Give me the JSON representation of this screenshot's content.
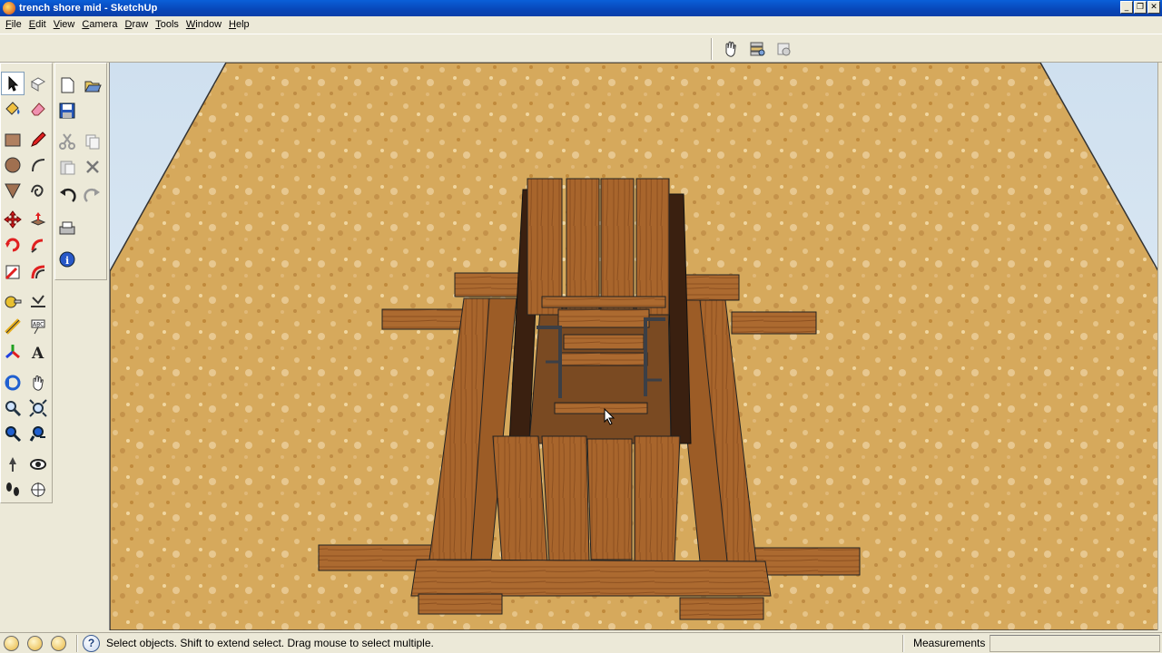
{
  "window": {
    "title": "trench shore mid - SketchUp",
    "buttons": {
      "minimize": "_",
      "restore": "❐",
      "close": "✕"
    }
  },
  "menu": [
    {
      "label": "File",
      "accel": "F",
      "rest": "ile"
    },
    {
      "label": "Edit",
      "accel": "E",
      "rest": "dit"
    },
    {
      "label": "View",
      "accel": "V",
      "rest": "iew"
    },
    {
      "label": "Camera",
      "accel": "C",
      "rest": "amera"
    },
    {
      "label": "Draw",
      "accel": "D",
      "rest": "raw"
    },
    {
      "label": "Tools",
      "accel": "T",
      "rest": "ools"
    },
    {
      "label": "Window",
      "accel": "W",
      "rest": "indow"
    },
    {
      "label": "Help",
      "accel": "H",
      "rest": "elp"
    }
  ],
  "top_toolbar": [
    "pan-hand-icon",
    "layer-manager-icon",
    "layers-icon"
  ],
  "left_toolbar": {
    "column1": [
      "select-icon",
      "paint-bucket-icon",
      "rectangle-icon",
      "circle-icon",
      "polygon-icon",
      "move-icon",
      "rotate-icon",
      "scale-icon",
      "tape-measure-icon",
      "dimension-icon",
      "axes-icon",
      "orbit-icon",
      "zoom-icon",
      "zoom-window-icon",
      "position-camera-icon",
      "walk-icon"
    ],
    "column1b": [
      "component-icon",
      "eraser-icon",
      "pencil-icon",
      "arc-icon",
      "freehand-icon",
      "push-pull-icon",
      "follow-me-icon",
      "offset-icon",
      "protractor-icon",
      "text-icon",
      "3d-text-icon",
      "pan-icon",
      "zoom-extents-icon",
      "previous-view-icon",
      "look-around-icon",
      "section-plane-icon"
    ],
    "column2": [
      "new-icon",
      "save-icon",
      "cut-icon",
      "paste-icon",
      "undo-icon",
      "print-icon",
      "model-info-icon"
    ],
    "column2b": [
      "open-icon",
      "copy-icon",
      "delete-icon",
      "redo-icon"
    ]
  },
  "status": {
    "text": "Select objects. Shift to extend select. Drag mouse to select multiple.",
    "help": "?",
    "measurements_label": "Measurements",
    "measurements_value": ""
  },
  "colors": {
    "sand": "#d9ab5c",
    "wood": "#a8652c",
    "wood_dark": "#7a4518",
    "sky": "#dce8f3"
  }
}
